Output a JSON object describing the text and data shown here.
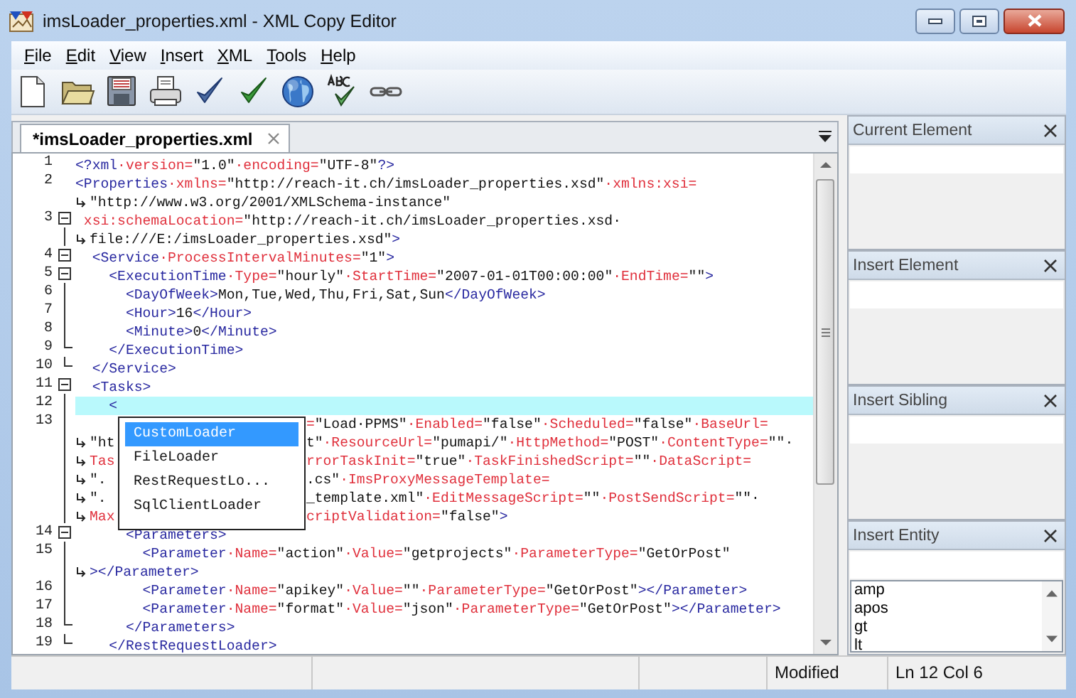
{
  "window": {
    "title": "imsLoader_properties.xml - XML Copy Editor"
  },
  "menu": [
    {
      "label": "File"
    },
    {
      "label": "Edit"
    },
    {
      "label": "View"
    },
    {
      "label": "Insert"
    },
    {
      "label": "XML"
    },
    {
      "label": "Tools"
    },
    {
      "label": "Help"
    }
  ],
  "toolbar": [
    {
      "kind": "new"
    },
    {
      "kind": "open"
    },
    {
      "kind": "save"
    },
    {
      "kind": "print"
    },
    {
      "kind": "check"
    },
    {
      "kind": "validate"
    },
    {
      "kind": "browser"
    },
    {
      "kind": "spelling"
    },
    {
      "kind": "link"
    }
  ],
  "tabs": [
    {
      "label": "*imsLoader_properties.xml",
      "selected": true
    }
  ],
  "editor": {
    "lines": [
      {
        "number": "1",
        "kind": "none",
        "current": false,
        "parts": [
          {
            "kind": "tag",
            "text": "<?xml"
          },
          {
            "kind": "attr",
            "text": "·version="
          },
          {
            "kind": "val",
            "text": "\"1.0\""
          },
          {
            "kind": "attr",
            "text": "·encoding="
          },
          {
            "kind": "val",
            "text": "\"UTF-8\""
          },
          {
            "kind": "tag",
            "text": "?>"
          }
        ]
      },
      {
        "number": "2",
        "kind": "none",
        "current": false,
        "parts": [
          {
            "kind": "tag",
            "text": "<Properties"
          },
          {
            "kind": "attr",
            "text": "·xmlns="
          },
          {
            "kind": "val",
            "text": "\"http://reach-it.ch/imsLoader_properties.xsd\""
          },
          {
            "kind": "attr",
            "text": "·xmlns:xsi="
          }
        ]
      },
      {
        "wrap": true,
        "kind": "none",
        "current": false,
        "parts": [
          {
            "kind": "val",
            "text": "\"http://www.w3.org/2001/XMLSchema-instance\""
          }
        ]
      },
      {
        "number": "3",
        "kind": "open",
        "current": false,
        "parts": [
          {
            "kind": "attr",
            "text": " xsi:schemaLocation="
          },
          {
            "kind": "val",
            "text": "\"http://reach-it.ch/imsLoader_properties.xsd·"
          }
        ]
      },
      {
        "wrap": true,
        "kind": "line",
        "current": false,
        "parts": [
          {
            "kind": "val",
            "text": "file:///E:/imsLoader_properties.xsd\""
          },
          {
            "kind": "tag",
            "text": ">"
          }
        ]
      },
      {
        "number": "4",
        "kind": "open",
        "current": false,
        "parts": [
          {
            "kind": "tag",
            "text": "  <Service"
          },
          {
            "kind": "attr",
            "text": "·ProcessIntervalMinutes="
          },
          {
            "kind": "val",
            "text": "\"1\""
          },
          {
            "kind": "tag",
            "text": ">"
          }
        ]
      },
      {
        "number": "5",
        "kind": "open",
        "current": false,
        "parts": [
          {
            "kind": "tag",
            "text": "    <ExecutionTime"
          },
          {
            "kind": "attr",
            "text": "·Type="
          },
          {
            "kind": "val",
            "text": "\"hourly\""
          },
          {
            "kind": "attr",
            "text": "·StartTime="
          },
          {
            "kind": "val",
            "text": "\"2007-01-01T00:00:00\""
          },
          {
            "kind": "attr",
            "text": "·EndTime="
          },
          {
            "kind": "val",
            "text": "\"\""
          },
          {
            "kind": "tag",
            "text": ">"
          }
        ]
      },
      {
        "number": "6",
        "kind": "line",
        "current": false,
        "parts": [
          {
            "kind": "tag",
            "text": "      <DayOfWeek>"
          },
          {
            "kind": "val",
            "text": "Mon,Tue,Wed,Thu,Fri,Sat,Sun"
          },
          {
            "kind": "tag",
            "text": "</DayOfWeek>"
          }
        ]
      },
      {
        "number": "7",
        "kind": "line",
        "current": false,
        "parts": [
          {
            "kind": "tag",
            "text": "      <Hour>"
          },
          {
            "kind": "val",
            "text": "16"
          },
          {
            "kind": "tag",
            "text": "</Hour>"
          }
        ]
      },
      {
        "number": "8",
        "kind": "line",
        "current": false,
        "parts": [
          {
            "kind": "tag",
            "text": "      <Minute>"
          },
          {
            "kind": "val",
            "text": "0"
          },
          {
            "kind": "tag",
            "text": "</Minute>"
          }
        ]
      },
      {
        "number": "9",
        "kind": "end",
        "current": false,
        "parts": [
          {
            "kind": "tag",
            "text": "    </ExecutionTime>"
          }
        ]
      },
      {
        "number": "10",
        "kind": "end",
        "current": false,
        "parts": [
          {
            "kind": "tag",
            "text": "  </Service>"
          }
        ]
      },
      {
        "number": "11",
        "kind": "open",
        "current": false,
        "parts": [
          {
            "kind": "tag",
            "text": "  <Tasks>"
          }
        ]
      },
      {
        "number": "12",
        "kind": "line",
        "current": true,
        "parts": [
          {
            "kind": "tag",
            "text": "    <"
          }
        ]
      },
      {
        "number": "13",
        "kind": "line",
        "current": false,
        "after_popup": [
          {
            "kind": "attr",
            "text": "="
          },
          {
            "kind": "val",
            "text": "\"Load·PPMS\""
          },
          {
            "kind": "attr",
            "text": "·Enabled="
          },
          {
            "kind": "val",
            "text": "\"false\""
          },
          {
            "kind": "attr",
            "text": "·Scheduled="
          },
          {
            "kind": "val",
            "text": "\"false\""
          },
          {
            "kind": "attr",
            "text": "·BaseUrl="
          }
        ]
      },
      {
        "wrap": true,
        "kind": "line",
        "current": false,
        "parts": [
          {
            "kind": "val",
            "text": "\"ht"
          }
        ],
        "after_popup": [
          {
            "kind": "val",
            "text": "t\""
          },
          {
            "kind": "attr",
            "text": "·ResourceUrl="
          },
          {
            "kind": "val",
            "text": "\"pumapi/\""
          },
          {
            "kind": "attr",
            "text": "·HttpMethod="
          },
          {
            "kind": "val",
            "text": "\"POST\""
          },
          {
            "kind": "attr",
            "text": "·ContentType="
          },
          {
            "kind": "val",
            "text": "\"\"·"
          }
        ]
      },
      {
        "wrap": true,
        "kind": "line",
        "current": false,
        "parts": [
          {
            "kind": "attr",
            "text": "Tas"
          }
        ],
        "after_popup": [
          {
            "kind": "attr",
            "text": "rrorTaskInit="
          },
          {
            "kind": "val",
            "text": "\"true\""
          },
          {
            "kind": "attr",
            "text": "·TaskFinishedScript="
          },
          {
            "kind": "val",
            "text": "\"\""
          },
          {
            "kind": "attr",
            "text": "·DataScript="
          }
        ]
      },
      {
        "wrap": true,
        "kind": "line",
        "current": false,
        "parts": [
          {
            "kind": "val",
            "text": "\"."
          }
        ],
        "after_popup": [
          {
            "kind": "val",
            "text": ".cs\""
          },
          {
            "kind": "attr",
            "text": "·ImsProxyMessageTemplate="
          }
        ]
      },
      {
        "wrap": true,
        "kind": "line",
        "current": false,
        "parts": [
          {
            "kind": "val",
            "text": "\"."
          }
        ],
        "after_popup": [
          {
            "kind": "val",
            "text": "_template.xml\""
          },
          {
            "kind": "attr",
            "text": "·EditMessageScript="
          },
          {
            "kind": "val",
            "text": "\"\""
          },
          {
            "kind": "attr",
            "text": "·PostSendScript="
          },
          {
            "kind": "val",
            "text": "\"\"·"
          }
        ]
      },
      {
        "wrap": true,
        "kind": "line",
        "current": false,
        "parts": [
          {
            "kind": "attr",
            "text": "Max"
          }
        ],
        "after_popup": [
          {
            "kind": "attr",
            "text": "criptValidation="
          },
          {
            "kind": "val",
            "text": "\"false\""
          },
          {
            "kind": "tag",
            "text": ">"
          }
        ]
      },
      {
        "number": "14",
        "kind": "open",
        "current": false,
        "parts": [
          {
            "kind": "tag",
            "text": "      <Parameters>"
          }
        ]
      },
      {
        "number": "15",
        "kind": "line",
        "current": false,
        "parts": [
          {
            "kind": "tag",
            "text": "        <Parameter"
          },
          {
            "kind": "attr",
            "text": "·Name="
          },
          {
            "kind": "val",
            "text": "\"action\""
          },
          {
            "kind": "attr",
            "text": "·Value="
          },
          {
            "kind": "val",
            "text": "\"getprojects\""
          },
          {
            "kind": "attr",
            "text": "·ParameterType="
          },
          {
            "kind": "val",
            "text": "\"GetOrPost\""
          }
        ]
      },
      {
        "wrap": true,
        "kind": "line",
        "current": false,
        "parts": [
          {
            "kind": "tag",
            "text": "></Parameter>"
          }
        ]
      },
      {
        "number": "16",
        "kind": "line",
        "current": false,
        "parts": [
          {
            "kind": "tag",
            "text": "        <Parameter"
          },
          {
            "kind": "attr",
            "text": "·Name="
          },
          {
            "kind": "val",
            "text": "\"apikey\""
          },
          {
            "kind": "attr",
            "text": "·Value="
          },
          {
            "kind": "val",
            "text": "\"\""
          },
          {
            "kind": "attr",
            "text": "·ParameterType="
          },
          {
            "kind": "val",
            "text": "\"GetOrPost\""
          },
          {
            "kind": "tag",
            "text": "></Parameter>"
          }
        ]
      },
      {
        "number": "17",
        "kind": "line",
        "current": false,
        "parts": [
          {
            "kind": "tag",
            "text": "        <Parameter"
          },
          {
            "kind": "attr",
            "text": "·Name="
          },
          {
            "kind": "val",
            "text": "\"format\""
          },
          {
            "kind": "attr",
            "text": "·Value="
          },
          {
            "kind": "val",
            "text": "\"json\""
          },
          {
            "kind": "attr",
            "text": "·ParameterType="
          },
          {
            "kind": "val",
            "text": "\"GetOrPost\""
          },
          {
            "kind": "tag",
            "text": "></Parameter>"
          }
        ]
      },
      {
        "number": "18",
        "kind": "end",
        "current": false,
        "parts": [
          {
            "kind": "tag",
            "text": "      </Parameters>"
          }
        ]
      },
      {
        "number": "19",
        "kind": "end",
        "current": false,
        "parts": [
          {
            "kind": "tag",
            "text": "    </RestRequestLoader>"
          }
        ]
      }
    ]
  },
  "autocomplete": {
    "items": [
      {
        "label": "CustomLoader",
        "selected": true
      },
      {
        "label": "FileLoader",
        "selected": false
      },
      {
        "label": "RestRequestLo...",
        "selected": false
      },
      {
        "label": "SqlClientLoader",
        "selected": false
      }
    ]
  },
  "panels": [
    {
      "title": "Current Element"
    },
    {
      "title": "Insert Element"
    },
    {
      "title": "Insert Sibling"
    },
    {
      "title": "Insert Entity",
      "list": [
        "amp",
        "apos",
        "gt",
        "lt"
      ]
    }
  ],
  "status_bar": {
    "state": "Modified",
    "position": "Ln 12 Col 6"
  }
}
